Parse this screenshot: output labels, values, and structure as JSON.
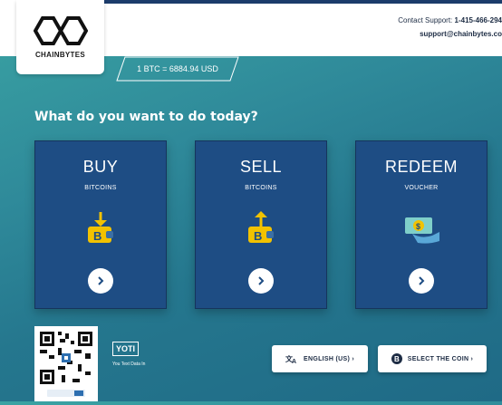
{
  "brand": {
    "name": "CHAINBYTES"
  },
  "support": {
    "label": "Contact Support:",
    "phone": "1-415-466-294",
    "email": "support@chainbytes.co"
  },
  "rate": {
    "text": "1 BTC = 6884.94 USD"
  },
  "heading": "What do you want to do today?",
  "cards": [
    {
      "title": "BUY",
      "subtitle": "BITCOINS",
      "icon": "wallet-arrow-in-icon"
    },
    {
      "title": "SELL",
      "subtitle": "BITCOINS",
      "icon": "wallet-arrow-out-icon"
    },
    {
      "title": "REDEEM",
      "subtitle": "VOUCHER",
      "icon": "hand-cash-icon"
    }
  ],
  "yoti": {
    "logo": "YOTI",
    "tagline": "You Text Data In"
  },
  "buttons": {
    "language": {
      "label": "ENGLISH (US) ›",
      "icon": "translate-icon"
    },
    "coin": {
      "label": "SELECT THE COIN ›",
      "icon": "bitcoin-icon"
    }
  },
  "colors": {
    "card_bg": "#1e4d84",
    "accent_yellow": "#f2c200",
    "bg_teal": "#3aa3a3",
    "text_dark": "#1d2c44"
  }
}
